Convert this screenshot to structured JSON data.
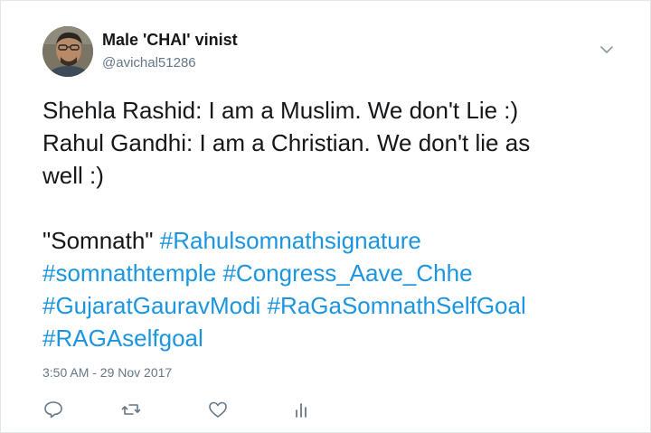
{
  "tweet": {
    "display_name": "Male 'CHAI' vinist",
    "handle": "@avichal51286",
    "lines": {
      "line1": "Shehla Rashid: I am a Muslim. We don't Lie :)",
      "line2": "Rahul Gandhi: I am a Christian. We don't lie as",
      "line3": "well :)",
      "somnath": "\"Somnath\"",
      "hashtags": [
        "#Rahulsomnathsignature",
        "#somnathtemple",
        "#Congress_Aave_Chhe",
        "#GujaratGauravModi",
        "#RaGaSomnathSelfGoal",
        "#RAGAselfgoal"
      ]
    },
    "timestamp": "3:50 AM - 29 Nov 2017"
  },
  "icons": {
    "avatar": "avatar-photo",
    "caret": "chevron-down-icon",
    "reply": "reply-icon",
    "retweet": "retweet-icon",
    "like": "heart-icon",
    "analytics": "analytics-icon"
  },
  "colors": {
    "text": "#14171a",
    "secondary": "#657786",
    "hashtag": "#1b95e0",
    "border": "#e1e8ed"
  }
}
